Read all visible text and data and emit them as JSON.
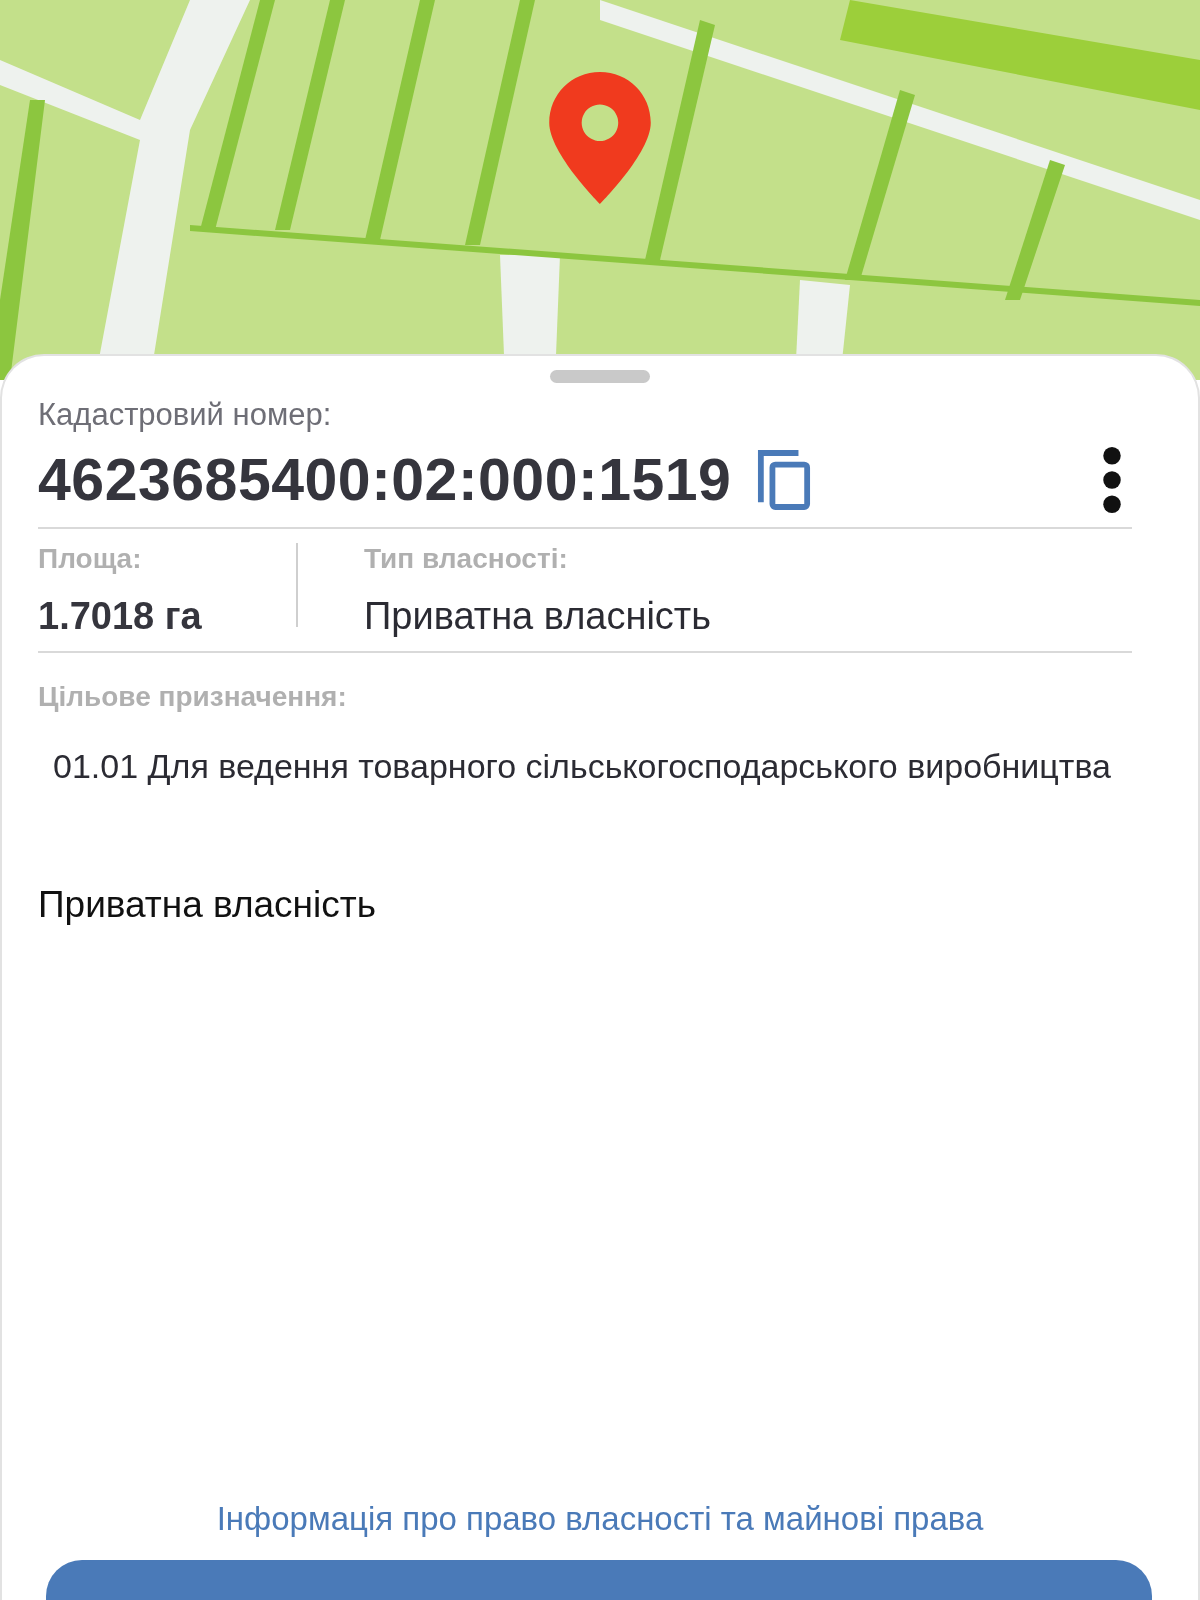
{
  "parcel": {
    "number_label": "Кадастровий номер:",
    "number": "4623685400:02:000:1519"
  },
  "area": {
    "label": "Площа:",
    "value": "1.7018 га"
  },
  "ownership_type": {
    "label": "Тип власності:",
    "value": "Приватна власність"
  },
  "purpose": {
    "label": "Цільове призначення:",
    "value": "01.01 Для ведення товарного сільськогосподарського виробництва"
  },
  "ownership_note": "Приватна власність",
  "rights_link": "Інформація про право власності та майнові права"
}
